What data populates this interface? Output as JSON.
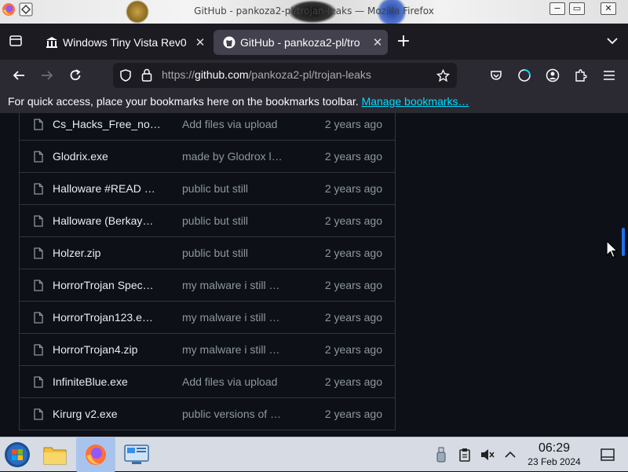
{
  "window": {
    "title": "GitHub - pankoza2-pl/trojan-leaks — Mozilla Firefox",
    "min_glyph": "−",
    "max_glyph": "▭",
    "close_glyph": "✕"
  },
  "tabs": [
    {
      "label": "Windows Tiny Vista Rev0",
      "active": false
    },
    {
      "label": "GitHub - pankoza2-pl/tro",
      "active": true
    }
  ],
  "url": {
    "prefix": "https://",
    "host": "github.com",
    "path": "/pankoza2-pl/trojan-leaks"
  },
  "bookmarks_bar": {
    "message": "For quick access, place your bookmarks here on the bookmarks toolbar.",
    "link": "Manage bookmarks…"
  },
  "files": [
    {
      "name": "Cs_Hacks_Free_no…",
      "message": "Add files via upload",
      "date": "2 years ago"
    },
    {
      "name": "Glodrix.exe",
      "message": "made by Glodrox l…",
      "date": "2 years ago"
    },
    {
      "name": "Halloware #READ …",
      "message": "public but still",
      "date": "2 years ago"
    },
    {
      "name": "Halloware (Berkay…",
      "message": "public but still",
      "date": "2 years ago"
    },
    {
      "name": "Holzer.zip",
      "message": "public but still",
      "date": "2 years ago"
    },
    {
      "name": "HorrorTrojan Spec…",
      "message": "my malware i still …",
      "date": "2 years ago"
    },
    {
      "name": "HorrorTrojan123.e…",
      "message": "my malware i still …",
      "date": "2 years ago"
    },
    {
      "name": "HorrorTrojan4.zip",
      "message": "my malware i still …",
      "date": "2 years ago"
    },
    {
      "name": "InfiniteBlue.exe",
      "message": "Add files via upload",
      "date": "2 years ago"
    },
    {
      "name": "Kirurg v2.exe",
      "message": "public versions of …",
      "date": "2 years ago"
    }
  ],
  "taskbar": {
    "time": "06:29",
    "date": "23 Feb 2024"
  },
  "colors": {
    "accent_link": "#00ddff",
    "github_bg": "#0d1117",
    "scroll_thumb": "#1f6feb"
  }
}
